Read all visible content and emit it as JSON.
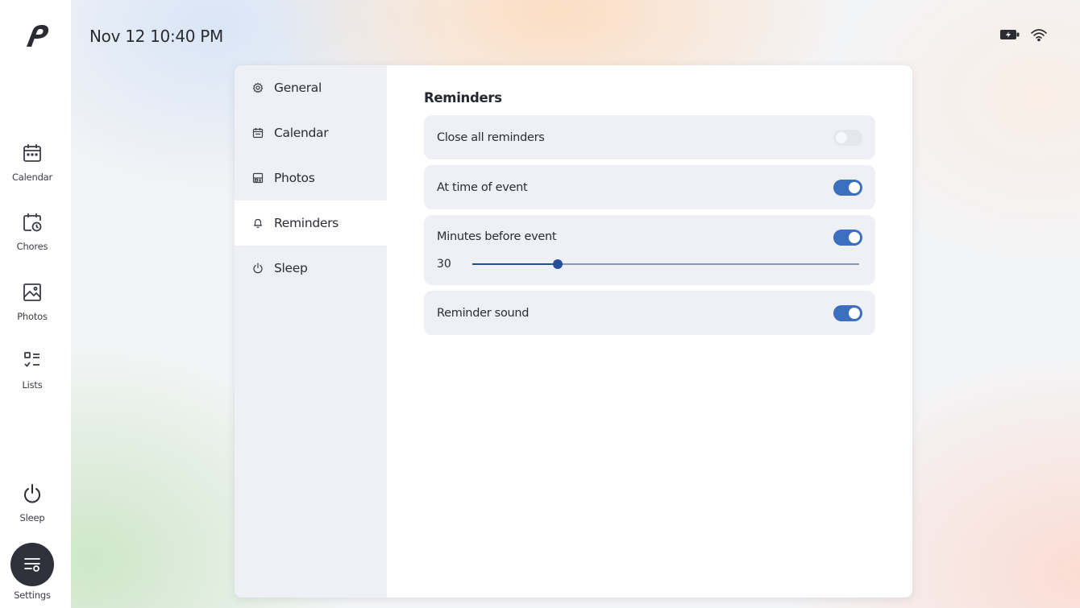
{
  "status_bar": {
    "datetime": "Nov 12 10:40 PM",
    "icons": [
      "battery-icon",
      "wifi-icon"
    ]
  },
  "sidebar": {
    "logo": "brand-logo",
    "items": [
      {
        "label": "Calendar",
        "icon": "calendar-icon"
      },
      {
        "label": "Chores",
        "icon": "chores-icon"
      },
      {
        "label": "Photos",
        "icon": "photos-icon"
      },
      {
        "label": "Lists",
        "icon": "lists-icon"
      }
    ],
    "bottom_items": [
      {
        "label": "Sleep",
        "icon": "power-icon"
      },
      {
        "label": "Settings",
        "icon": "settings-icon",
        "active": true
      }
    ]
  },
  "settings": {
    "nav": [
      {
        "label": "General",
        "icon": "gear-icon",
        "active": false
      },
      {
        "label": "Calendar",
        "icon": "calendar-icon",
        "active": false
      },
      {
        "label": "Photos",
        "icon": "photos-icon",
        "active": false
      },
      {
        "label": "Reminders",
        "icon": "bell-icon",
        "active": true
      },
      {
        "label": "Sleep",
        "icon": "power-icon",
        "active": false
      }
    ],
    "section_title": "Reminders",
    "options": [
      {
        "label": "Close all reminders",
        "enabled": false
      },
      {
        "label": "At time of event",
        "enabled": true
      },
      {
        "label": "Minutes before event",
        "enabled": true,
        "value": "30",
        "slider_fraction": 0.22
      },
      {
        "label": "Reminder sound",
        "enabled": true
      }
    ]
  },
  "colors": {
    "accent": "#3c6fbf",
    "slider": "#24509a",
    "nav_bg": "#eef0f6",
    "card_bg": "#eef0f6",
    "settings_button": "#2f323a"
  }
}
